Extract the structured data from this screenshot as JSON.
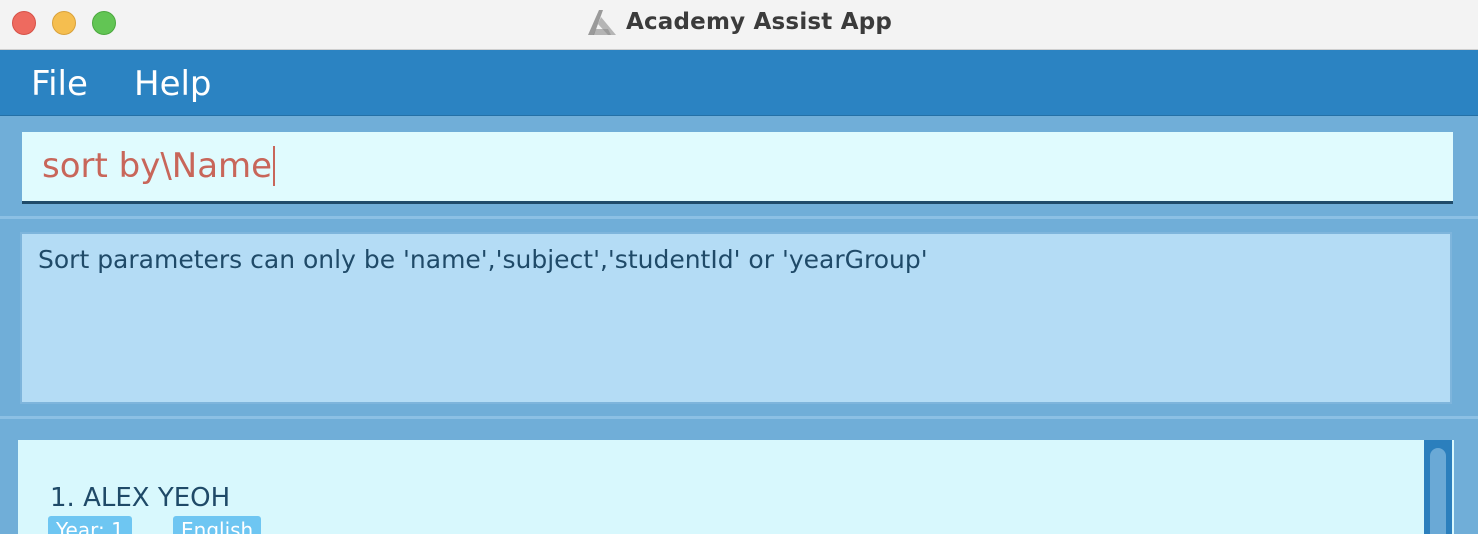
{
  "window": {
    "title": "Academy Assist App",
    "logo_icon": "app-logo-icon"
  },
  "menubar": {
    "items": [
      {
        "label": "File"
      },
      {
        "label": "Help"
      }
    ]
  },
  "command": {
    "value": "sort by\\Name",
    "text_color": "#c8665a"
  },
  "result": {
    "message": "Sort parameters can only be 'name','subject','studentId' or 'yearGroup'"
  },
  "students": [
    {
      "index_name": "1. ALEX YEOH",
      "year_tag": "Year: 1",
      "subject_tag": "English"
    }
  ],
  "colors": {
    "menu_bar": "#2b83c2",
    "panel_background": "#70aed8",
    "command_box": "#e0fbfe",
    "result_box": "#b4dcf5",
    "list_background": "#d8f8fd",
    "tag": "#6ec6f2"
  }
}
